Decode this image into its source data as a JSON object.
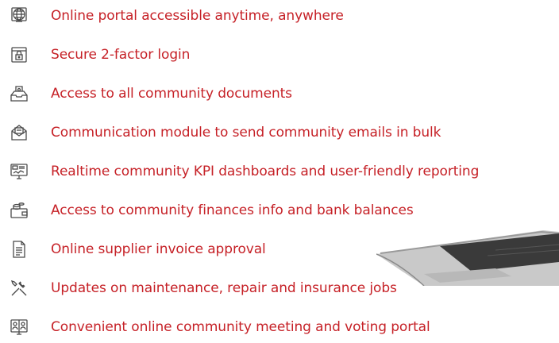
{
  "accent_color": "#c62127",
  "icon_color": "#4a4a4a",
  "features": [
    {
      "icon": "globe-monitor-icon",
      "label": "Online portal accessible anytime, anywhere"
    },
    {
      "icon": "secure-lock-screen-icon",
      "label": "Secure 2-factor login"
    },
    {
      "icon": "document-tray-icon",
      "label": "Access to all community documents"
    },
    {
      "icon": "email-envelope-icon",
      "label": "Communication module to send community emails in bulk"
    },
    {
      "icon": "dashboard-monitor-icon",
      "label": "Realtime community KPI dashboards and user-friendly reporting"
    },
    {
      "icon": "wallet-coins-icon",
      "label": "Access to community finances info and bank balances"
    },
    {
      "icon": "invoice-document-icon",
      "label": "Online supplier invoice approval"
    },
    {
      "icon": "wrench-screwdriver-icon",
      "label": "Updates on maintenance, repair and insurance jobs"
    },
    {
      "icon": "meeting-voting-icon",
      "label": "Convenient online community meeting and voting portal"
    }
  ]
}
